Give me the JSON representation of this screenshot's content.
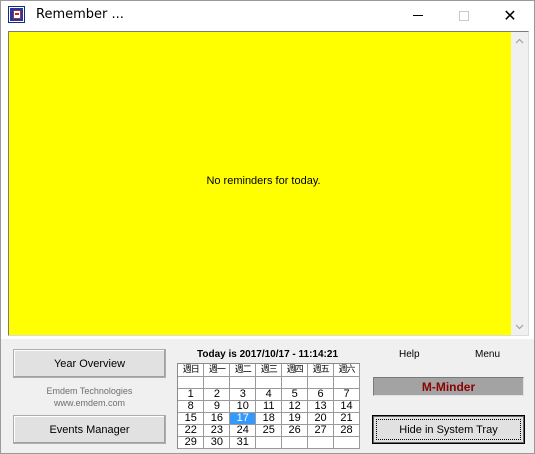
{
  "window": {
    "title": "Remember ..."
  },
  "titlebar": {
    "minimize_icon": "minimize-icon",
    "maximize_icon": "maximize-icon",
    "close_icon": "close-icon",
    "close_glyph": "✕"
  },
  "reminders": {
    "message": "No reminders for today."
  },
  "buttons": {
    "year_overview": "Year Overview",
    "events_manager": "Events Manager",
    "hide_tray": "Hide in System Tray"
  },
  "company": {
    "name": "Emdem Technologies",
    "url": "www.emdem.com"
  },
  "today": {
    "label": "Today is 2017/10/17 - 11:14:21"
  },
  "calendar": {
    "weekdays": [
      "週日",
      "週一",
      "週二",
      "週三",
      "週四",
      "週五",
      "週六"
    ],
    "weeks": [
      [
        "",
        "",
        "",
        "",
        "",
        "",
        ""
      ],
      [
        "1",
        "2",
        "3",
        "4",
        "5",
        "6",
        "7"
      ],
      [
        "8",
        "9",
        "10",
        "11",
        "12",
        "13",
        "14"
      ],
      [
        "15",
        "16",
        "17",
        "18",
        "19",
        "20",
        "21"
      ],
      [
        "22",
        "23",
        "24",
        "25",
        "26",
        "27",
        "28"
      ],
      [
        "29",
        "30",
        "31",
        "",
        "",
        "",
        ""
      ]
    ],
    "selected_day": "17",
    "selected_color": "#3399ff"
  },
  "links": {
    "help": "Help",
    "menu": "Menu"
  },
  "product": {
    "name": "M-Minder",
    "color": "#8b0000"
  },
  "colors": {
    "reminder_background": "#ffff00"
  }
}
